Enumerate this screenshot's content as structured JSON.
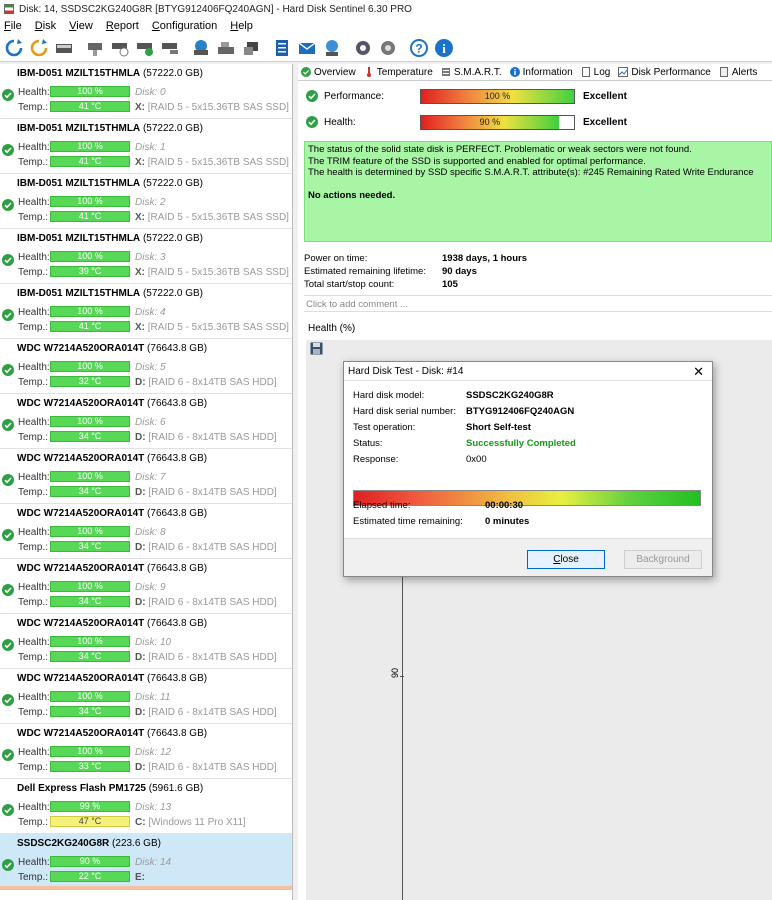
{
  "window": {
    "title": "Disk: 14, SSDSC2KG240G8R [BTYG912406FQ240AGN]  -  Hard Disk Sentinel 6.30 PRO"
  },
  "menu": [
    "File",
    "Disk",
    "View",
    "Report",
    "Configuration",
    "Help"
  ],
  "toolbar": {
    "icons": [
      "refresh-icon",
      "refresh-all-icon",
      "disk-drive-icon",
      "disk-info-icon",
      "disk-test-icon",
      "disk-check-icon",
      "disk-remove-icon",
      "backup-icon",
      "backup-disk-icon",
      "backup-copy-icon",
      "report-icon",
      "email-icon",
      "network-icon",
      "settings-icon",
      "alert-settings-icon",
      "help-icon",
      "info-icon"
    ]
  },
  "labels": {
    "health": "Health:",
    "temp": "Temp.:"
  },
  "disks": [
    {
      "model": "IBM-D051 MZILT15THMLA",
      "capacity": "(57222.0 GB)",
      "health": "100 %",
      "temp": "41 °C",
      "disk": "Disk: 0",
      "vol_letter": "X:",
      "vol_desc": "[RAID 5 - 5x15.36TB SAS SSD]"
    },
    {
      "model": "IBM-D051 MZILT15THMLA",
      "capacity": "(57222.0 GB)",
      "health": "100 %",
      "temp": "41 °C",
      "disk": "Disk: 1",
      "vol_letter": "X:",
      "vol_desc": "[RAID 5 - 5x15.36TB SAS SSD]"
    },
    {
      "model": "IBM-D051 MZILT15THMLA",
      "capacity": "(57222.0 GB)",
      "health": "100 %",
      "temp": "41 °C",
      "disk": "Disk: 2",
      "vol_letter": "X:",
      "vol_desc": "[RAID 5 - 5x15.36TB SAS SSD]"
    },
    {
      "model": "IBM-D051 MZILT15THMLA",
      "capacity": "(57222.0 GB)",
      "health": "100 %",
      "temp": "39 °C",
      "disk": "Disk: 3",
      "vol_letter": "X:",
      "vol_desc": "[RAID 5 - 5x15.36TB SAS SSD]"
    },
    {
      "model": "IBM-D051 MZILT15THMLA",
      "capacity": "(57222.0 GB)",
      "health": "100 %",
      "temp": "41 °C",
      "disk": "Disk: 4",
      "vol_letter": "X:",
      "vol_desc": "[RAID 5 - 5x15.36TB SAS SSD]"
    },
    {
      "model": "WDC      W7214A520ORA014T",
      "capacity": "(76643.8 GB)",
      "health": "100 %",
      "temp": "32 °C",
      "disk": "Disk: 5",
      "vol_letter": "D:",
      "vol_desc": "[RAID 6 - 8x14TB SAS HDD]"
    },
    {
      "model": "WDC      W7214A520ORA014T",
      "capacity": "(76643.8 GB)",
      "health": "100 %",
      "temp": "34 °C",
      "disk": "Disk: 6",
      "vol_letter": "D:",
      "vol_desc": "[RAID 6 - 8x14TB SAS HDD]"
    },
    {
      "model": "WDC      W7214A520ORA014T",
      "capacity": "(76643.8 GB)",
      "health": "100 %",
      "temp": "34 °C",
      "disk": "Disk: 7",
      "vol_letter": "D:",
      "vol_desc": "[RAID 6 - 8x14TB SAS HDD]"
    },
    {
      "model": "WDC      W7214A520ORA014T",
      "capacity": "(76643.8 GB)",
      "health": "100 %",
      "temp": "34 °C",
      "disk": "Disk: 8",
      "vol_letter": "D:",
      "vol_desc": "[RAID 6 - 8x14TB SAS HDD]"
    },
    {
      "model": "WDC      W7214A520ORA014T",
      "capacity": "(76643.8 GB)",
      "health": "100 %",
      "temp": "34 °C",
      "disk": "Disk: 9",
      "vol_letter": "D:",
      "vol_desc": "[RAID 6 - 8x14TB SAS HDD]"
    },
    {
      "model": "WDC      W7214A520ORA014T",
      "capacity": "(76643.8 GB)",
      "health": "100 %",
      "temp": "34 °C",
      "disk": "Disk: 10",
      "vol_letter": "D:",
      "vol_desc": "[RAID 6 - 8x14TB SAS HDD]"
    },
    {
      "model": "WDC      W7214A520ORA014T",
      "capacity": "(76643.8 GB)",
      "health": "100 %",
      "temp": "34 °C",
      "disk": "Disk: 11",
      "vol_letter": "D:",
      "vol_desc": "[RAID 6 - 8x14TB SAS HDD]"
    },
    {
      "model": "WDC      W7214A520ORA014T",
      "capacity": "(76643.8 GB)",
      "health": "100 %",
      "temp": "33 °C",
      "disk": "Disk: 12",
      "vol_letter": "D:",
      "vol_desc": "[RAID 6 - 8x14TB SAS HDD]"
    },
    {
      "model": "Dell Express Flash PM1725",
      "capacity": "(5961.6 GB)",
      "health": "99 %",
      "temp": "47 °C",
      "disk": "Disk: 13",
      "vol_letter": "C:",
      "vol_desc": "[Windows 11 Pro X11]",
      "warm": true
    },
    {
      "model": "SSDSC2KG240G8R",
      "capacity": "(223.6 GB)",
      "health": "90 %",
      "temp": "22 °C",
      "disk": "Disk: 14",
      "vol_letter": "E:",
      "vol_desc": "",
      "selected": true
    }
  ],
  "tabs": [
    {
      "label": "Overview",
      "icon": "check-icon"
    },
    {
      "label": "Temperature",
      "icon": "thermometer-icon"
    },
    {
      "label": "S.M.A.R.T.",
      "icon": "list-icon"
    },
    {
      "label": "Information",
      "icon": "info-icon"
    },
    {
      "label": "Log",
      "icon": "log-icon"
    },
    {
      "label": "Disk Performance",
      "icon": "chart-icon"
    },
    {
      "label": "Alerts",
      "icon": "alert-icon"
    }
  ],
  "overview": {
    "performance_label": "Performance:",
    "performance_value": "100 %",
    "performance_pct": 100,
    "performance_rating": "Excellent",
    "health_label": "Health:",
    "health_value": "90 %",
    "health_pct": 90,
    "health_rating": "Excellent",
    "status_lines": [
      "The status of the solid state disk is PERFECT. Problematic or weak sectors were not found.",
      "The TRIM feature of the SSD is supported and enabled for optimal performance.",
      "The health is determined by SSD specific S.M.A.R.T. attribute(s):  #245 Remaining Rated Write Endurance"
    ],
    "no_actions": "No actions needed.",
    "power_on_label": "Power on time:",
    "power_on_value": "1938 days, 1 hours",
    "lifetime_label": "Estimated remaining lifetime:",
    "lifetime_value": "90 days",
    "startstop_label": "Total start/stop count:",
    "startstop_value": "105",
    "comment_placeholder": "Click to add comment ...",
    "graph_label": "Health (%)",
    "graph_tick": "90"
  },
  "dialog": {
    "title": "Hard Disk Test - Disk: #14",
    "model_label": "Hard disk model:",
    "model_value": "SSDSC2KG240G8R",
    "serial_label": "Hard disk serial number:",
    "serial_value": "BTYG912406FQ240AGN",
    "op_label": "Test operation:",
    "op_value": "Short Self-test",
    "status_label": "Status:",
    "status_value": "Successfully Completed",
    "response_label": "Response:",
    "response_value": "0x00",
    "progress_pct": 100,
    "elapsed_label": "Elapsed time:",
    "elapsed_value": "00:00:30",
    "remaining_label": "Estimated time remaining:",
    "remaining_value": "0 minutes",
    "close_label": "Close",
    "background_label": "Background"
  },
  "colors": {
    "ok_green": "#2ea043",
    "bar_green": "#57d957",
    "status_bg": "#a7f5a5",
    "warm_yellow": "#f4f07a",
    "selected_blue": "#cfe8f8"
  }
}
